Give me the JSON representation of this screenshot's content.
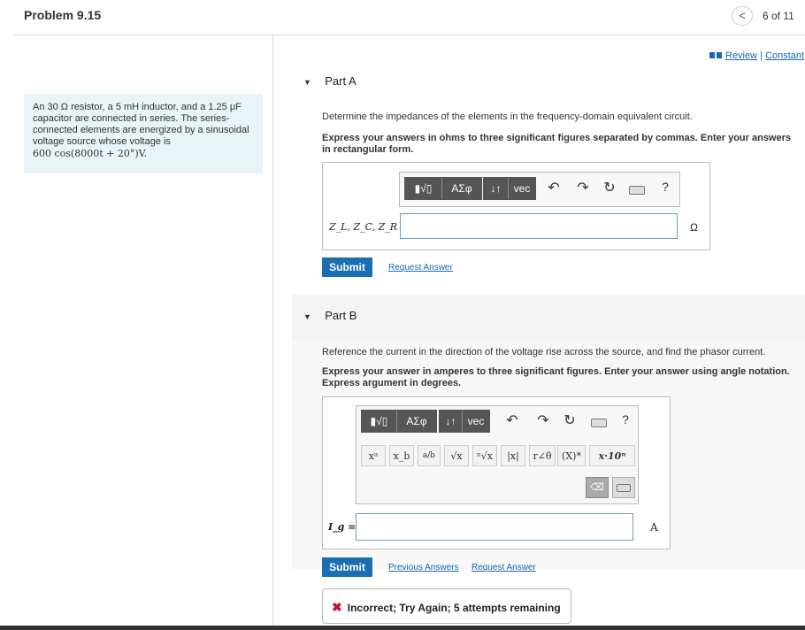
{
  "header": {
    "title": "Problem 9.15",
    "nav_prev": "<",
    "counter": "6 of 11"
  },
  "problem": {
    "line1": "An 30 Ω resistor, a 5 mH inductor, and a 1.25 μF",
    "line2": "capacitor are connected in series. The series-",
    "line3": "connected elements are energized by a sinusoidal",
    "line4": "voltage source whose voltage is",
    "line5": "600 cos(8000t + 20°)V."
  },
  "links": {
    "review": "Review",
    "sep": "|",
    "constants": "Constant"
  },
  "partA": {
    "label": "Part A",
    "question": "Determine the impedances of the elements in the frequency-domain equivalent circuit.",
    "instruction": "Express your answers in ohms to three significant figures separated by commas. Enter your answers in rectangular form.",
    "toolbar": {
      "templates": "▮√▯",
      "greek": "ΑΣφ",
      "arrows": "↓↑",
      "vec": "vec",
      "help": "?"
    },
    "input_label": "Z_L, Z_C, Z_R =",
    "unit": "Ω",
    "submit": "Submit",
    "request": "Request Answer"
  },
  "partB": {
    "label": "Part B",
    "question": "Reference the current in the direction of the voltage rise across the source, and find the phasor current.",
    "instruction1": "Express your answer in amperes to three significant figures. Enter your answer using angle notation.",
    "instruction2": "Express argument in degrees.",
    "toolbar": {
      "templates": "▮√▯",
      "greek": "ΑΣφ",
      "arrows": "↓↑",
      "vec": "vec",
      "help": "?"
    },
    "symbols": [
      "xᵃ",
      "x_b",
      "a/b",
      "√x",
      "ⁿ√x",
      "|x|",
      "r∠θ",
      "(X)*",
      "x·10ⁿ"
    ],
    "input_label": "I_g =",
    "unit": "A",
    "submit": "Submit",
    "previous": "Previous Answers",
    "request": "Request Answer"
  },
  "feedback": {
    "text": "Incorrect; Try Again; 5 attempts remaining"
  }
}
